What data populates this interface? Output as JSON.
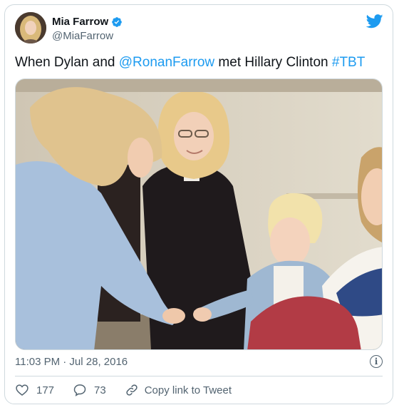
{
  "tweet": {
    "author": {
      "display_name": "Mia Farrow",
      "handle": "@MiaFarrow",
      "verified": true,
      "avatar_icon": "profile-avatar"
    },
    "text": {
      "part1": "When Dylan and ",
      "mention": "@RonanFarrow",
      "part2": " met Hillary Clinton ",
      "hashtag": "#TBT"
    },
    "timestamp": "11:03 PM · Jul 28, 2016",
    "info_icon": "i",
    "actions": {
      "like_count": "177",
      "reply_count": "73",
      "copy_link_label": "Copy link to Tweet"
    }
  },
  "colors": {
    "brand_blue": "#1d9bf0",
    "text_primary": "#0f1419",
    "text_secondary": "#536471",
    "border": "#cfd9de"
  }
}
